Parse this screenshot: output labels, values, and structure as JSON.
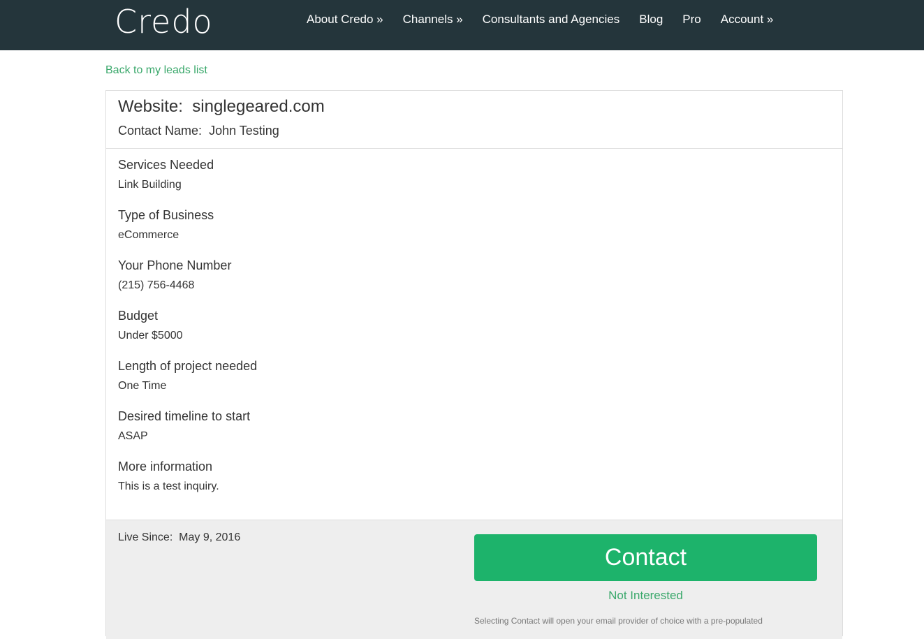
{
  "nav": {
    "logo": "Credo",
    "items": [
      {
        "label": "About Credo »"
      },
      {
        "label": "Channels »"
      },
      {
        "label": "Consultants and Agencies"
      },
      {
        "label": "Blog"
      },
      {
        "label": "Pro"
      },
      {
        "label": "Account »"
      }
    ]
  },
  "back_link": "Back to my leads list",
  "lead": {
    "website_label": "Website:",
    "website": "singlegeared.com",
    "contact_label": "Contact Name:",
    "contact_name": "John Testing",
    "fields": [
      {
        "label": "Services Needed",
        "value": "Link Building"
      },
      {
        "label": "Type of Business",
        "value": "eCommerce"
      },
      {
        "label": "Your Phone Number",
        "value": "(215) 756-4468"
      },
      {
        "label": "Budget",
        "value": "Under $5000"
      },
      {
        "label": "Length of project needed",
        "value": "One Time"
      },
      {
        "label": "Desired timeline to start",
        "value": "ASAP"
      },
      {
        "label": "More information",
        "value": "This is a test inquiry."
      }
    ],
    "live_since_label": "Live Since:",
    "live_since": "May 9, 2016"
  },
  "actions": {
    "contact_label": "Contact",
    "not_interested_label": "Not Interested",
    "fine_print": "Selecting Contact will open your email provider of choice with a pre-populated"
  },
  "colors": {
    "navbar": "#24353b",
    "accent_green": "#1db36b",
    "link_green": "#3aa86b"
  }
}
